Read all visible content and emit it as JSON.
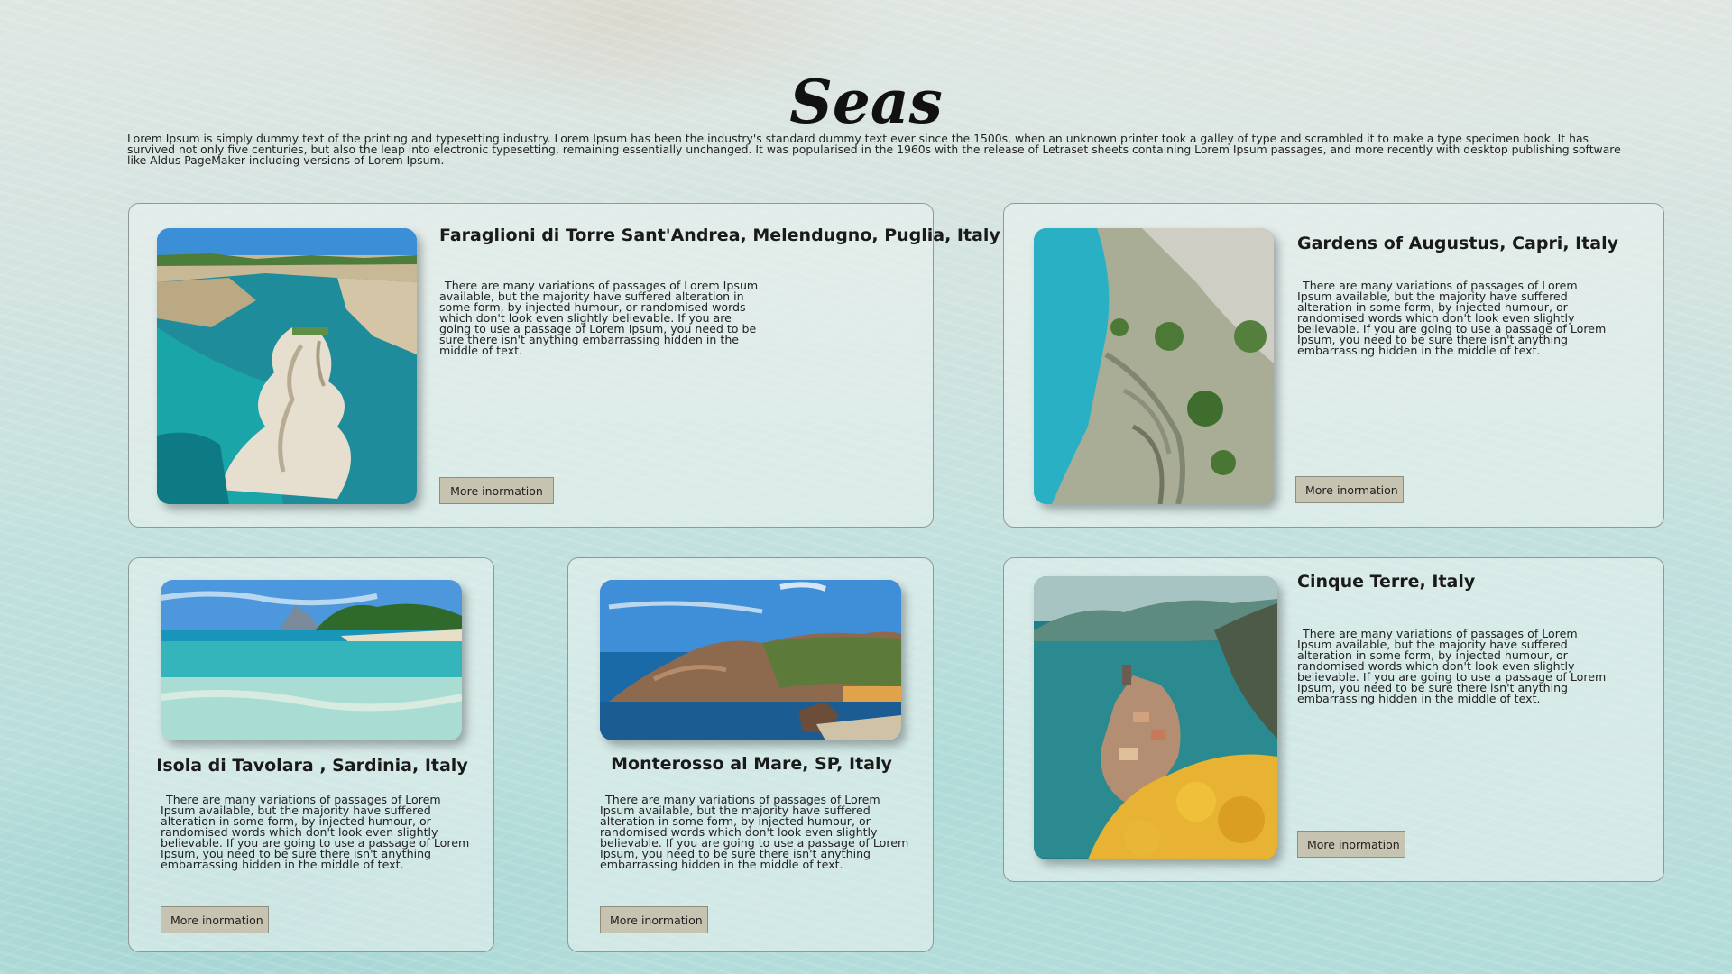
{
  "page": {
    "title": "Seas",
    "intro": "Lorem Ipsum is simply dummy text of the printing and typesetting industry. Lorem Ipsum has been the industry's standard dummy text ever since the 1500s, when an unknown printer took a galley of type and scrambled it to make a type specimen book. It has survived not only five centuries, but also the leap into electronic typesetting, remaining essentially unchanged. It was popularised in the 1960s with the release of Letraset sheets containing Lorem Ipsum passages, and more recently with desktop publishing software like Aldus PageMaker including versions of Lorem Ipsum."
  },
  "cards": [
    {
      "title": "Faraglioni di Torre Sant'Andrea, Melendugno, Puglia, Italy",
      "text": "There are many variations of passages of Lorem Ipsum available, but the majority have suffered alteration in some form, by injected humour, or randomised words which don't look even slightly believable. If you are going to use a passage of Lorem Ipsum, you need to be sure there isn't anything embarrassing hidden in the middle of text.",
      "button": "More inormation"
    },
    {
      "title": "Gardens of Augustus, Capri, Italy",
      "text": "There are many variations of passages of Lorem Ipsum available, but the majority have suffered alteration in some form, by injected humour, or randomised words which don't look even slightly believable. If you are going to use a passage of Lorem Ipsum, you need to be sure there isn't anything embarrassing hidden in the middle of text.",
      "button": "More inormation"
    },
    {
      "title": "Isola di Tavolara , Sardinia, Italy",
      "text": "There are many variations of passages of Lorem Ipsum available, but the majority have suffered alteration in some form, by injected humour, or randomised words which don't look even slightly believable. If you are going to use a passage of Lorem Ipsum, you need to be sure there isn't anything embarrassing hidden in the middle of text.",
      "button": "More inormation"
    },
    {
      "title": "Monterosso al Mare, SP, Italy",
      "text": "There are many variations of passages of Lorem Ipsum available, but the majority have suffered alteration in some form, by injected humour, or randomised words which don't look even slightly believable. If you are going to use a passage of Lorem Ipsum, you need to be sure there isn't anything embarrassing hidden in the middle of text.",
      "button": "More inormation"
    },
    {
      "title": "Cinque Terre, Italy",
      "text": "There are many variations of passages of Lorem Ipsum available, but the majority have suffered alteration in some form, by injected humour, or randomised words which don't look even slightly believable. If you are going to use a passage of Lorem Ipsum, you need to be sure there isn't anything embarrassing hidden in the middle of text.",
      "button": "More inormation"
    }
  ]
}
